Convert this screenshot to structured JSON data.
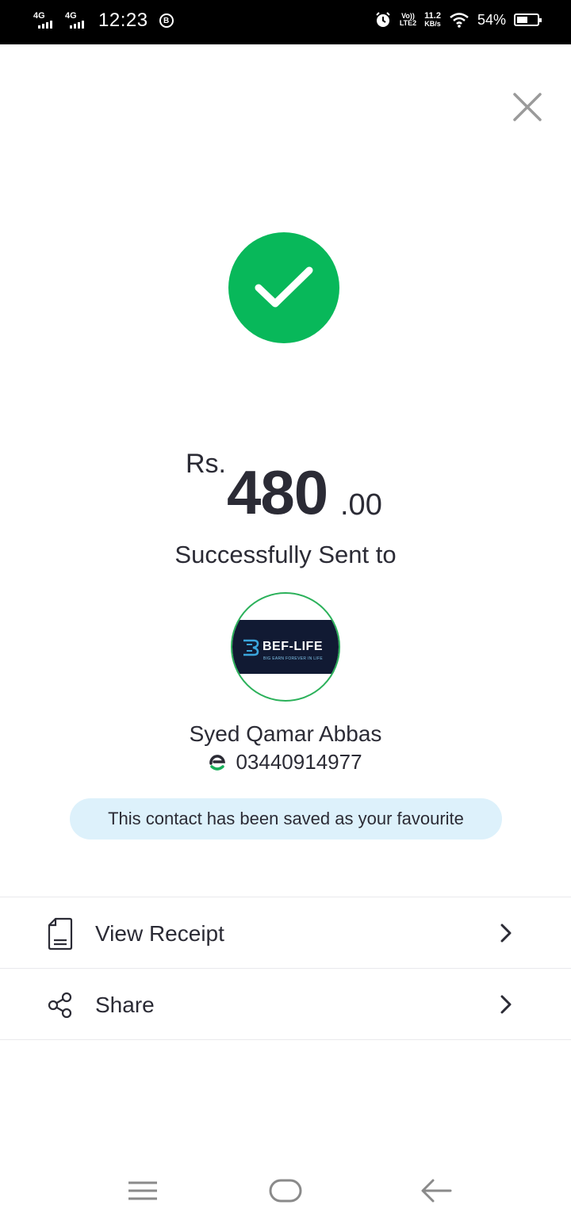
{
  "status_bar": {
    "sim1_network": "4G",
    "sim2_network": "4G",
    "time": "12:23",
    "app_badge": "B",
    "volte_top": "Vo))",
    "volte_bottom": "LTE2",
    "speed_value": "11.2",
    "speed_unit": "KB/s",
    "battery_percent": "54%",
    "battery_level": 0.54
  },
  "close_icon": "close-icon",
  "success_icon": "checkmark-icon",
  "accent_color": "#08b85a",
  "transaction": {
    "currency": "Rs.",
    "amount_main": "480",
    "amount_decimal": ".00",
    "status_text": "Successfully Sent to"
  },
  "recipient": {
    "avatar_logo_text": "BEF-LIFE",
    "avatar_logo_tagline": "BIG EARN FOREVER IN LIFE",
    "name": "Syed Qamar Abbas",
    "phone": "03440914977",
    "wallet_icon": "easypaisa-icon"
  },
  "favourite_note": "This contact has been saved as your favourite",
  "actions": [
    {
      "label": "View Receipt",
      "icon": "receipt-icon"
    },
    {
      "label": "Share",
      "icon": "share-icon"
    }
  ],
  "nav": {
    "menu_icon": "menu-icon",
    "home_icon": "home-icon",
    "back_icon": "back-icon"
  }
}
